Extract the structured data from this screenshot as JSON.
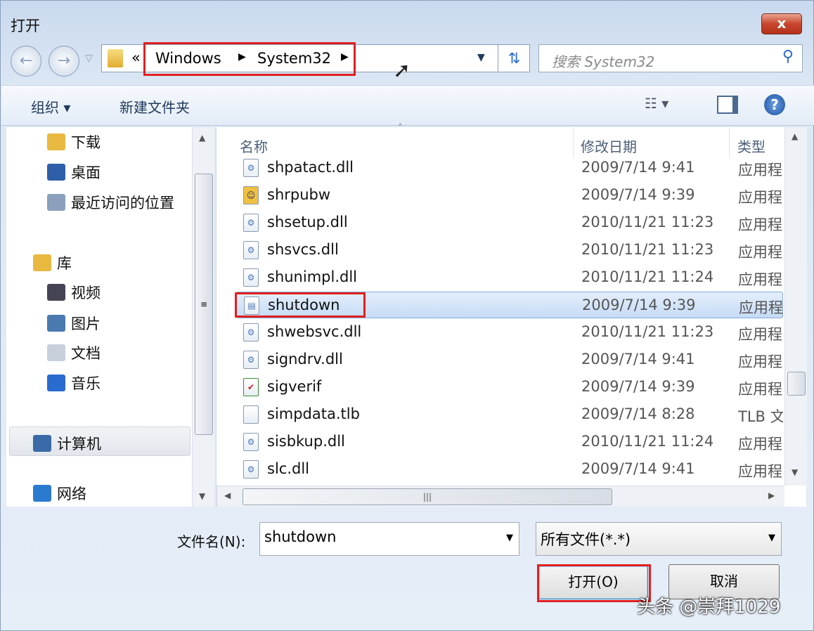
{
  "window": {
    "title": "打开",
    "close_label": "x"
  },
  "address": {
    "overflow": "«",
    "crumbs": [
      "Windows",
      "System32"
    ],
    "search_placeholder": "搜索 System32"
  },
  "toolbar": {
    "organize": "组织 ▾",
    "new_folder": "新建文件夹"
  },
  "nav": {
    "items": [
      {
        "label": "下载",
        "icon": "downloads-folder-icon",
        "color": "#e8b840"
      },
      {
        "label": "桌面",
        "icon": "desktop-icon",
        "color": "#2f5fa8"
      },
      {
        "label": "最近访问的位置",
        "icon": "recent-places-icon",
        "color": "#8aa0bd"
      },
      {
        "label": "库",
        "icon": "library-icon",
        "color": "#e8b840"
      },
      {
        "label": "视频",
        "icon": "video-icon",
        "color": "#445"
      },
      {
        "label": "图片",
        "icon": "pictures-icon",
        "color": "#4a7ab0"
      },
      {
        "label": "文档",
        "icon": "documents-icon",
        "color": "#c8d0dc"
      },
      {
        "label": "音乐",
        "icon": "music-icon",
        "color": "#2a6bd0"
      },
      {
        "label": "计算机",
        "icon": "computer-icon",
        "color": "#3a6aa8"
      },
      {
        "label": "网络",
        "icon": "network-icon",
        "color": "#2a7ad0"
      }
    ]
  },
  "list": {
    "columns": [
      "名称",
      "修改日期",
      "类型"
    ],
    "rows": [
      {
        "name": "shpatact.dll",
        "date": "2009/7/14 9:41",
        "type": "应用程",
        "icon": "dll-icon"
      },
      {
        "name": "shrpubw",
        "date": "2009/7/14 9:39",
        "type": "应用程",
        "icon": "share-wizard-icon"
      },
      {
        "name": "shsetup.dll",
        "date": "2010/11/21 11:23",
        "type": "应用程",
        "icon": "dll-icon"
      },
      {
        "name": "shsvcs.dll",
        "date": "2010/11/21 11:23",
        "type": "应用程",
        "icon": "dll-icon"
      },
      {
        "name": "shunimpl.dll",
        "date": "2010/11/21 11:24",
        "type": "应用程",
        "icon": "dll-icon"
      },
      {
        "name": "shutdown",
        "date": "2009/7/14 9:39",
        "type": "应用程",
        "icon": "exe-icon",
        "selected": true
      },
      {
        "name": "shwebsvc.dll",
        "date": "2010/11/21 11:23",
        "type": "应用程",
        "icon": "dll-icon"
      },
      {
        "name": "signdrv.dll",
        "date": "2009/7/14 9:41",
        "type": "应用程",
        "icon": "dll-icon"
      },
      {
        "name": "sigverif",
        "date": "2009/7/14 9:39",
        "type": "应用程",
        "icon": "sigverif-icon"
      },
      {
        "name": "simpdata.tlb",
        "date": "2009/7/14 8:28",
        "type": "TLB 文",
        "icon": "file-icon"
      },
      {
        "name": "sisbkup.dll",
        "date": "2010/11/21 11:24",
        "type": "应用程",
        "icon": "dll-icon"
      },
      {
        "name": "slc.dll",
        "date": "2009/7/14 9:41",
        "type": "应用程",
        "icon": "dll-icon"
      }
    ]
  },
  "footer": {
    "filename_label": "文件名(N):",
    "filename_value": "shutdown",
    "filter_value": "所有文件(*.*)",
    "open_label": "打开(O)",
    "cancel_label": "取消"
  },
  "watermark": "头条 @崇拜1029",
  "colors": {
    "highlight": "#e02020",
    "selection": "#c6dcf6"
  }
}
